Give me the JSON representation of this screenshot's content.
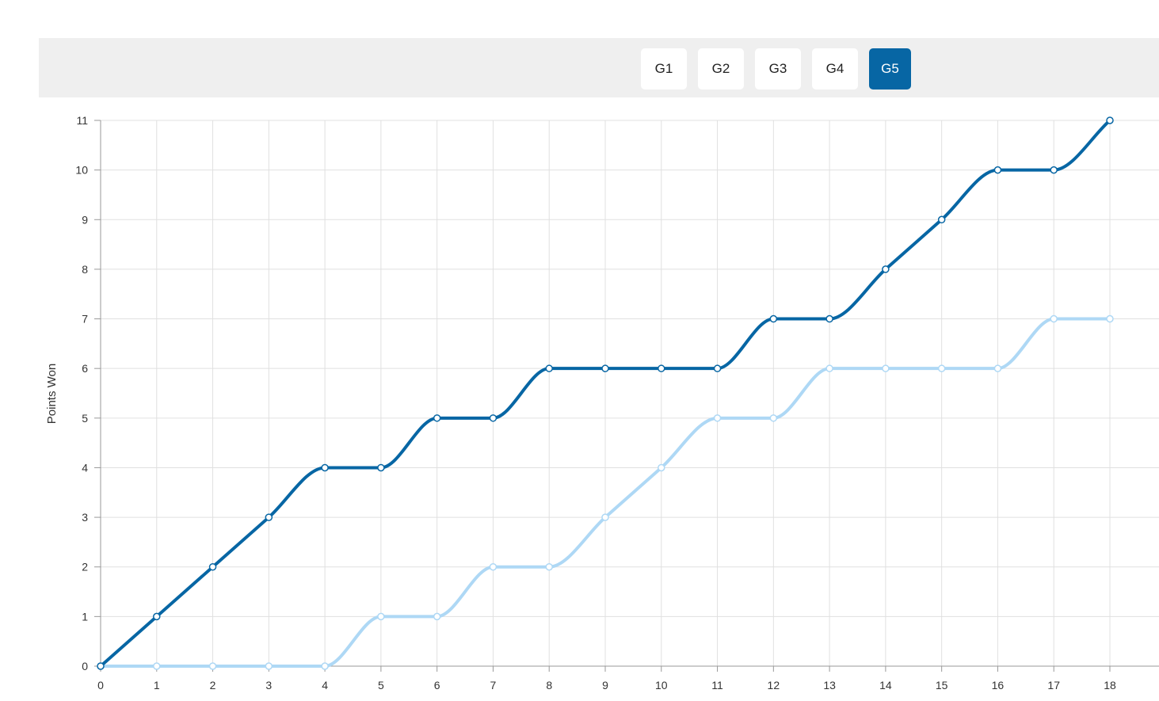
{
  "tabs": [
    {
      "label": "G1",
      "active": false
    },
    {
      "label": "G2",
      "active": false
    },
    {
      "label": "G3",
      "active": false
    },
    {
      "label": "G4",
      "active": false
    },
    {
      "label": "G5",
      "active": true
    }
  ],
  "colors": {
    "accent": "#0766a4",
    "series_dark": "#0766a4",
    "series_light": "#aed8f5",
    "grid": "#e0e0e0",
    "axis": "#999999"
  },
  "chart_data": {
    "type": "line",
    "ylabel": "Points Won",
    "xlabel": "",
    "xlim": [
      0,
      18
    ],
    "ylim": [
      0,
      11
    ],
    "grid": true,
    "x_ticks": [
      0,
      1,
      2,
      3,
      4,
      5,
      6,
      7,
      8,
      9,
      10,
      11,
      12,
      13,
      14,
      15,
      16,
      17,
      18
    ],
    "y_ticks": [
      0,
      1,
      2,
      3,
      4,
      5,
      6,
      7,
      8,
      9,
      10,
      11
    ],
    "x": [
      0,
      1,
      2,
      3,
      4,
      5,
      6,
      7,
      8,
      9,
      10,
      11,
      12,
      13,
      14,
      15,
      16,
      17,
      18
    ],
    "series": [
      {
        "color": "#0766a4",
        "values": [
          0,
          1,
          2,
          3,
          4,
          4,
          5,
          5,
          6,
          6,
          6,
          6,
          7,
          7,
          8,
          9,
          10,
          10,
          11
        ]
      },
      {
        "color": "#aed8f5",
        "values": [
          0,
          0,
          0,
          0,
          0,
          1,
          1,
          2,
          2,
          3,
          4,
          5,
          5,
          6,
          6,
          6,
          6,
          7,
          7
        ]
      }
    ]
  }
}
